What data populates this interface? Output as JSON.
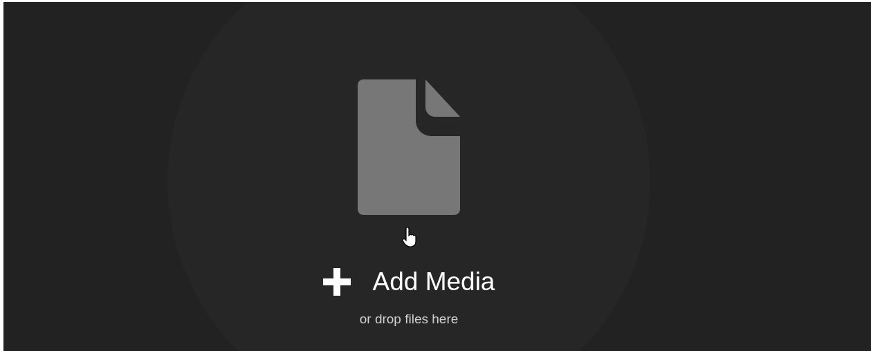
{
  "upload": {
    "button_label": "Add Media",
    "hint": "or drop files here"
  }
}
